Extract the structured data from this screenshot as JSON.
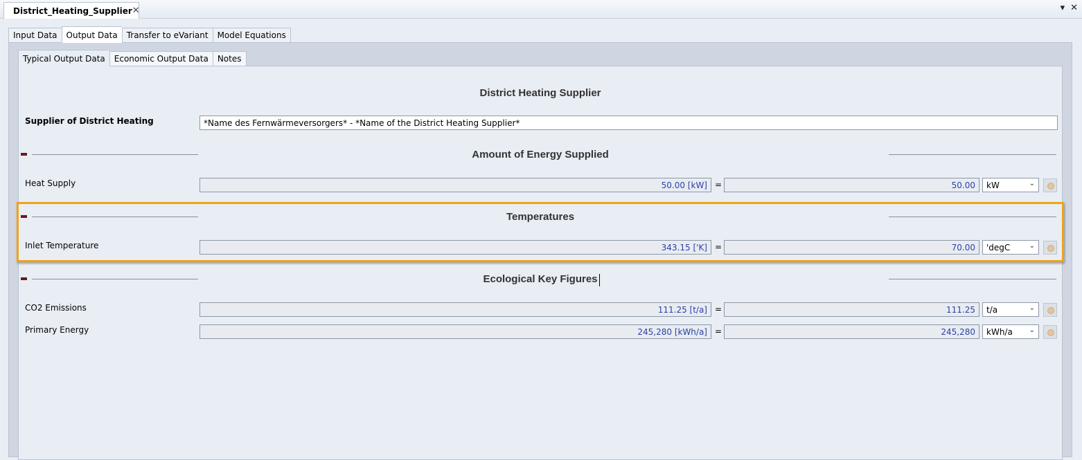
{
  "document": {
    "tab_title": "District_Heating_Supplier",
    "close_glyph": "✕",
    "menu_glyph": "▾",
    "window_close_glyph": "✕"
  },
  "main_tabs": [
    "Input Data",
    "Output Data",
    "Transfer to eVariant",
    "Model Equations"
  ],
  "sub_tabs": [
    "Typical Output Data",
    "Economic Output Data",
    "Notes"
  ],
  "page_title": "District Heating Supplier",
  "supplier": {
    "label": "Supplier of District Heating",
    "value": "*Name des Fernwärmeversorgers* - *Name of the District Heating Supplier*"
  },
  "sections": [
    {
      "title": "Amount of Energy Supplied",
      "rows": [
        {
          "label": "Heat Supply",
          "si_value": "50.00 [kW]",
          "equals": "=",
          "display_value": "50.00",
          "unit": "kW"
        }
      ]
    },
    {
      "title": "Temperatures",
      "rows": [
        {
          "label": "Inlet Temperature",
          "si_value": "343.15 ['K]",
          "equals": "=",
          "display_value": "70.00",
          "unit": "'degC"
        }
      ]
    },
    {
      "title": "Ecological Key Figures",
      "rows": [
        {
          "label": "CO2 Emissions",
          "si_value": "111.25 [t/a]",
          "equals": "=",
          "display_value": "111.25",
          "unit": "t/a"
        },
        {
          "label": "Primary Energy",
          "si_value": "245,280 [kWh/a]",
          "equals": "=",
          "display_value": "245,280",
          "unit": "kWh/a"
        }
      ]
    }
  ],
  "colors": {
    "highlight_border": "#f2a313",
    "value_text": "#2b3fa8",
    "collapse_button": "#6b1a1a"
  }
}
